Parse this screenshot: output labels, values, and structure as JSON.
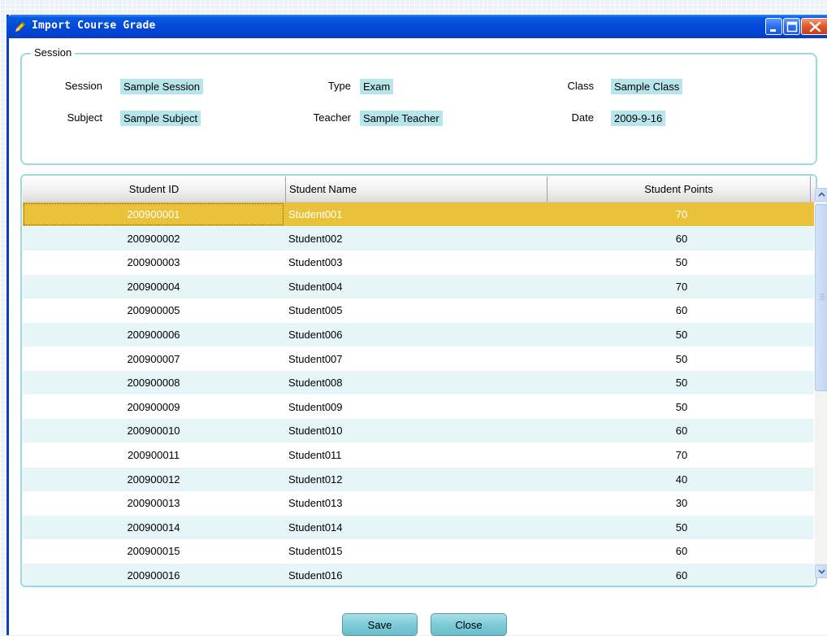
{
  "window": {
    "title": "Import Course Grade",
    "title_bar_color": "#0449d8"
  },
  "session": {
    "legend": "Session",
    "fields": {
      "session": {
        "label": "Session",
        "value": "Sample Session"
      },
      "type": {
        "label": "Type",
        "value": "Exam"
      },
      "class": {
        "label": "Class",
        "value": "Sample Class"
      },
      "subject": {
        "label": "Subject",
        "value": "Sample Subject"
      },
      "teacher": {
        "label": "Teacher",
        "value": "Sample Teacher"
      },
      "date": {
        "label": "Date",
        "value": "2009-9-16"
      }
    }
  },
  "grid": {
    "columns": [
      "Student ID",
      "Student Name",
      "Student Points"
    ],
    "selected_row": 0,
    "rows": [
      {
        "id": "200900001",
        "name": "Student001",
        "points": "70"
      },
      {
        "id": "200900002",
        "name": "Student002",
        "points": "60"
      },
      {
        "id": "200900003",
        "name": "Student003",
        "points": "50"
      },
      {
        "id": "200900004",
        "name": "Student004",
        "points": "70"
      },
      {
        "id": "200900005",
        "name": "Student005",
        "points": "60"
      },
      {
        "id": "200900006",
        "name": "Student006",
        "points": "50"
      },
      {
        "id": "200900007",
        "name": "Student007",
        "points": "50"
      },
      {
        "id": "200900008",
        "name": "Student008",
        "points": "50"
      },
      {
        "id": "200900009",
        "name": "Student009",
        "points": "50"
      },
      {
        "id": "200900010",
        "name": "Student010",
        "points": "60"
      },
      {
        "id": "200900011",
        "name": "Student011",
        "points": "70"
      },
      {
        "id": "200900012",
        "name": "Student012",
        "points": "40"
      },
      {
        "id": "200900013",
        "name": "Student013",
        "points": "30"
      },
      {
        "id": "200900014",
        "name": "Student014",
        "points": "50"
      },
      {
        "id": "200900015",
        "name": "Student015",
        "points": "60"
      },
      {
        "id": "200900016",
        "name": "Student016",
        "points": "60"
      }
    ]
  },
  "buttons": {
    "save": "Save",
    "close": "Close"
  },
  "colors": {
    "selected_row": "#e9c13a",
    "alt_row": "#e6f5f8",
    "accent": "#9dd9e4",
    "value_highlight": "#b7e5ec"
  },
  "icons": {
    "app": "pencil-icon",
    "minimize": "minimize-icon",
    "maximize": "maximize-icon",
    "close": "close-icon",
    "scroll_up": "chevron-up-icon",
    "scroll_down": "chevron-down-icon"
  }
}
